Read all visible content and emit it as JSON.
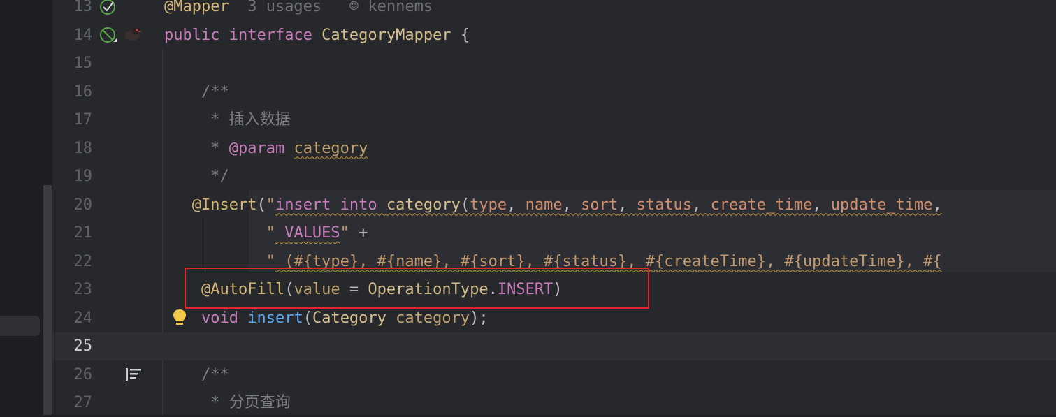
{
  "editor": {
    "lines": [
      {
        "num": "13",
        "segments": [
          {
            "t": "@Mapper",
            "c": "anno"
          },
          {
            "t": "  3 usages   ",
            "c": "hint"
          },
          {
            "t": "☺",
            "c": "hint"
          },
          {
            "t": " kennems",
            "c": "hint"
          }
        ]
      },
      {
        "num": "14",
        "segments": [
          {
            "t": "public ",
            "c": "kw2"
          },
          {
            "t": "interface ",
            "c": "kw2"
          },
          {
            "t": "CategoryMapper",
            "c": "cls"
          },
          {
            "t": " {",
            "c": "plain"
          }
        ]
      },
      {
        "num": "15",
        "segments": []
      },
      {
        "num": "16",
        "segments": [
          {
            "t": "    /**",
            "c": "cmt"
          }
        ]
      },
      {
        "num": "17",
        "segments": [
          {
            "t": "     * 插入数据",
            "c": "cmt"
          }
        ]
      },
      {
        "num": "18",
        "segments": [
          {
            "t": "     * ",
            "c": "cmt"
          },
          {
            "t": "@param",
            "c": "jtag"
          },
          {
            "t": " ",
            "c": "cmt"
          },
          {
            "t": "category",
            "c": "param wavy"
          }
        ]
      },
      {
        "num": "19",
        "segments": [
          {
            "t": "     */",
            "c": "cmt"
          }
        ]
      },
      {
        "num": "20",
        "segments": [
          {
            "t": "   @Insert",
            "c": "anno"
          },
          {
            "t": "(",
            "c": "plain"
          },
          {
            "t": "\"",
            "c": "str"
          },
          {
            "t": "insert into ",
            "c": "kw2 wavy"
          },
          {
            "t": "category",
            "c": "cls wavy"
          },
          {
            "t": "(",
            "c": "plain wavy"
          },
          {
            "t": "type",
            "c": "kw wavy"
          },
          {
            "t": ", ",
            "c": "plain wavy"
          },
          {
            "t": "name",
            "c": "kw wavy"
          },
          {
            "t": ", ",
            "c": "plain wavy"
          },
          {
            "t": "sort",
            "c": "kw wavy"
          },
          {
            "t": ", ",
            "c": "plain wavy"
          },
          {
            "t": "status",
            "c": "kw wavy"
          },
          {
            "t": ", ",
            "c": "plain wavy"
          },
          {
            "t": "create_time",
            "c": "kw wavy"
          },
          {
            "t": ", ",
            "c": "plain wavy"
          },
          {
            "t": "update_time",
            "c": "kw wavy"
          },
          {
            "t": ",",
            "c": "plain wavy"
          }
        ]
      },
      {
        "num": "21",
        "segments": [
          {
            "t": "           ",
            "c": "plain"
          },
          {
            "t": "\"",
            "c": "str"
          },
          {
            "t": " VALUES",
            "c": "kw2 wavy"
          },
          {
            "t": "\"",
            "c": "str"
          },
          {
            "t": " +",
            "c": "plain"
          }
        ]
      },
      {
        "num": "22",
        "segments": [
          {
            "t": "           ",
            "c": "plain"
          },
          {
            "t": "\"",
            "c": "str"
          },
          {
            "t": " (#{type}, #{name}, #{sort}, #{status}, #{createTime}, #{updateTime}, #{",
            "c": "str wavy"
          }
        ]
      },
      {
        "num": "23",
        "segments": [
          {
            "t": "    @AutoFill",
            "c": "anno"
          },
          {
            "t": "(",
            "c": "plain"
          },
          {
            "t": "value",
            "c": "param"
          },
          {
            "t": " = ",
            "c": "plain"
          },
          {
            "t": "OperationType",
            "c": "cls"
          },
          {
            "t": ".",
            "c": "plain"
          },
          {
            "t": "INSERT",
            "c": "enum"
          },
          {
            "t": ")",
            "c": "plain"
          }
        ]
      },
      {
        "num": "24",
        "segments": [
          {
            "t": "    ",
            "c": "plain"
          },
          {
            "t": "void",
            "c": "kw2"
          },
          {
            "t": " ",
            "c": "plain"
          },
          {
            "t": "insert",
            "c": "method"
          },
          {
            "t": "(",
            "c": "plain"
          },
          {
            "t": "Category",
            "c": "cls"
          },
          {
            "t": " ",
            "c": "plain"
          },
          {
            "t": "category",
            "c": "param"
          },
          {
            "t": ");",
            "c": "plain"
          }
        ]
      },
      {
        "num": "25",
        "segments": []
      },
      {
        "num": "26",
        "segments": [
          {
            "t": "    /**",
            "c": "cmt"
          }
        ]
      },
      {
        "num": "27",
        "segments": [
          {
            "t": "     * 分页查询",
            "c": "cmt"
          }
        ]
      }
    ],
    "current_line": "25",
    "highlighted_line": "23"
  },
  "colors": {
    "highlight_box": "#e3252d",
    "background": "#26282c",
    "current_line_bg": "#2d2f34"
  },
  "icons": {
    "line13": "implemented-icon",
    "line14": "mybatis-bird-icon",
    "line24": "lightbulb-icon",
    "line26": "structure-icon"
  }
}
